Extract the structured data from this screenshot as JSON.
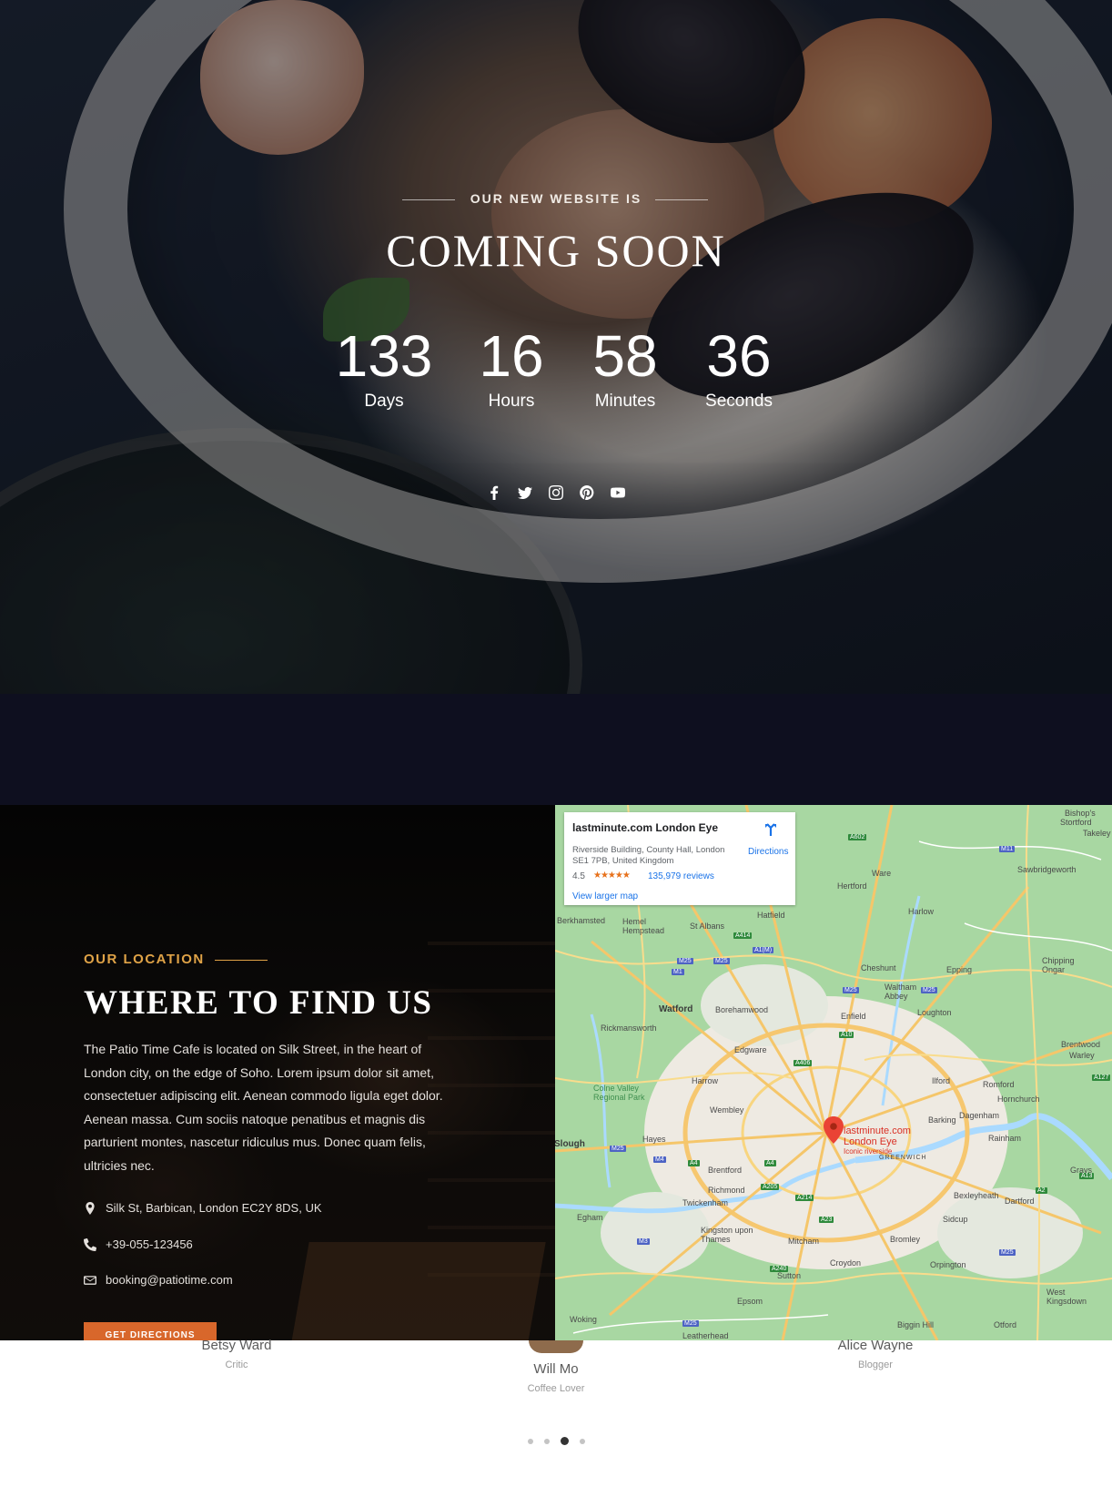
{
  "hero": {
    "eyebrow": "OUR NEW WEBSITE IS",
    "title": "COMING SOON",
    "countdown": [
      {
        "value": "133",
        "label": "Days"
      },
      {
        "value": "16",
        "label": "Hours"
      },
      {
        "value": "58",
        "label": "Minutes"
      },
      {
        "value": "36",
        "label": "Seconds"
      }
    ],
    "social_icons": [
      "facebook-icon",
      "twitter-icon",
      "instagram-icon",
      "pinterest-icon",
      "youtube-icon"
    ]
  },
  "location": {
    "eyebrow": "OUR LOCATION",
    "title": "WHERE TO FIND US",
    "description": "The Patio Time Cafe is located on Silk Street, in the heart of London city, on the edge of Soho. Lorem ipsum dolor sit amet, consectetuer adipiscing elit. Aenean commodo ligula eget dolor. Aenean massa. Cum sociis natoque penatibus et magnis dis parturient montes, nascetur ridiculus mus. Donec quam felis, ultricies nec.",
    "address": "Silk St, Barbican, London EC2Y 8DS, UK",
    "phone": "+39-055-123456",
    "email": "booking@patiotime.com",
    "button": "GET DIRECTIONS",
    "accent_color": "#e0a347",
    "button_color": "#d8672b"
  },
  "map": {
    "card": {
      "title": "lastminute.com London Eye",
      "address": "Riverside Building, County Hall, London SE1 7PB, United Kingdom",
      "rating": "4.5",
      "stars": "★★★★★",
      "reviews": "135,979 reviews",
      "larger_map": "View larger map",
      "directions": "Directions"
    },
    "pin": {
      "line1": "lastminute.com",
      "line2": "London Eye",
      "sub": "Iconic riverside"
    },
    "places": [
      "Stortford",
      "Takeley",
      "Ware",
      "Hertford",
      "Sawbridgeworth",
      "Harlow",
      "Berkhamsted",
      "Hemel Hempstead",
      "St Albans",
      "Hatfield",
      "Watford",
      "Borehamwood",
      "Enfield",
      "Waltham Abbey",
      "Epping",
      "Chipping Ongar",
      "Cheshunt",
      "Loughton",
      "Rickmansworth",
      "Edgware",
      "Harrow",
      "Colne Valley Regional Park",
      "Wembley",
      "Ilford",
      "Romford",
      "Hornchurch",
      "Brentwood",
      "Warley",
      "Barking",
      "Dagenham",
      "Rainham",
      "Hayes",
      "Slough",
      "Brentford",
      "Richmond",
      "Twickenham",
      "Egham",
      "Kingston upon Thames",
      "Mitcham",
      "Croydon",
      "Sutton",
      "Epsom",
      "Bromley",
      "Sidcup",
      "Bexleyheath",
      "Dartford",
      "Orpington",
      "West Kingsdown",
      "Woking",
      "Biggin Hill",
      "Otford",
      "Leatherhead",
      "GREENWICH",
      "Grays",
      "Bishop's"
    ]
  },
  "testimonials": {
    "people": [
      {
        "name": "Betsy Ward",
        "role": "Critic"
      },
      {
        "name": "Will Mo",
        "role": "Coffee Lover"
      },
      {
        "name": "Alice Wayne",
        "role": "Blogger"
      }
    ],
    "pagination_count": 4,
    "active_page": 3
  }
}
